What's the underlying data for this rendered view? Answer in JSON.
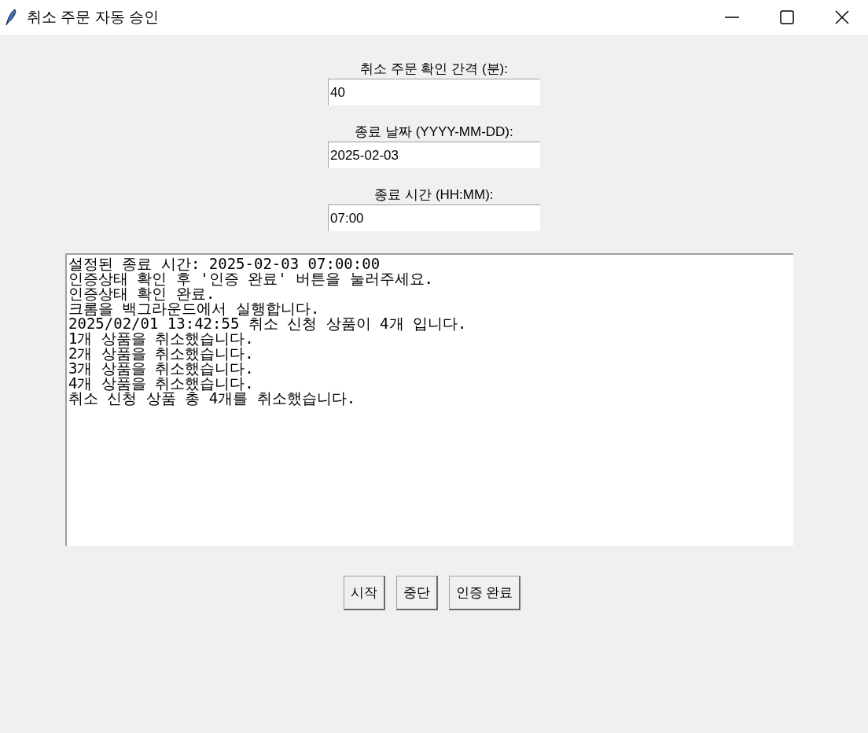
{
  "window": {
    "title": "취소 주문 자동 승인"
  },
  "fields": [
    {
      "label": "취소 주문 확인 간격 (분):",
      "value": "40"
    },
    {
      "label": "종료 날짜 (YYYY-MM-DD):",
      "value": "2025-02-03"
    },
    {
      "label": "종료 시간 (HH:MM):",
      "value": "07:00"
    }
  ],
  "log": [
    "설정된 종료 시간: 2025-02-03 07:00:00",
    "인증상태 확인 후 '인증 완료' 버튼을 눌러주세요.",
    "인증상태 확인 완료.",
    "크롬을 백그라운드에서 실행합니다.",
    "2025/02/01 13:42:55 취소 신청 상품이 4개 입니다.",
    "1개 상품을 취소했습니다.",
    "2개 상품을 취소했습니다.",
    "3개 상품을 취소했습니다.",
    "4개 상품을 취소했습니다.",
    "취소 신청 상품 총 4개를 취소했습니다."
  ],
  "buttons": [
    "시작",
    "중단",
    "인증 완료"
  ]
}
